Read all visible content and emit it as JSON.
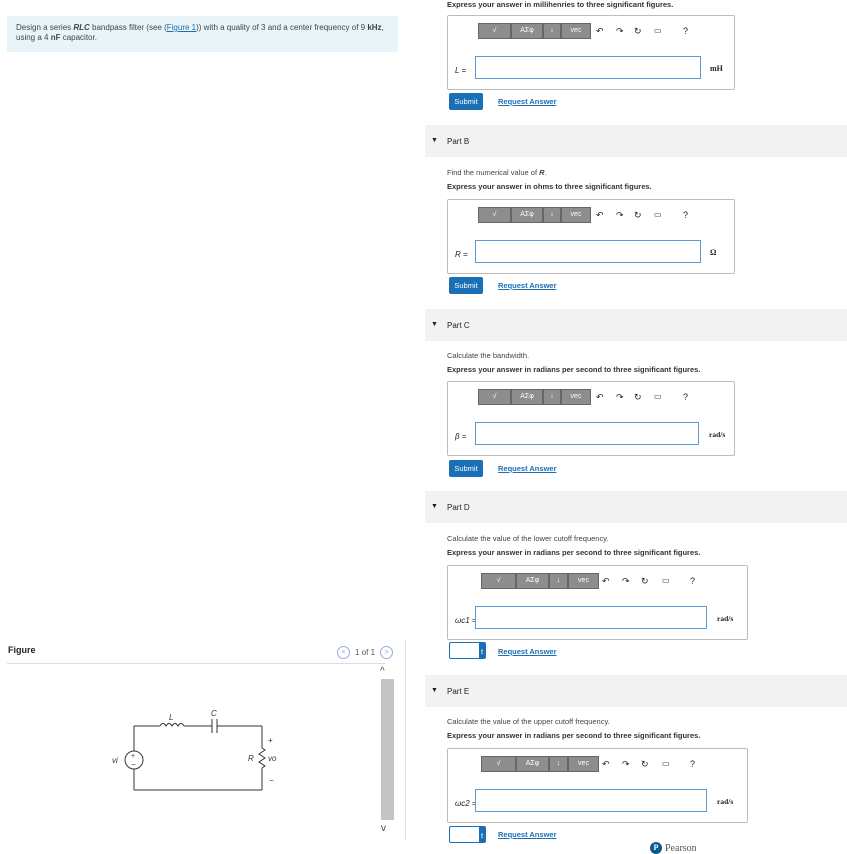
{
  "problem": {
    "text_before": "Design a series ",
    "rlc": "RLC",
    "text_mid": " bandpass filter (see (",
    "figure_link": "Figure 1",
    "text_mid2": ")) with a quality of 3 and a center frequency of 9 ",
    "khz": "kHz",
    "text_after": ", using a 4 ",
    "nf": "nF",
    "text_end": " capacitor."
  },
  "figure": {
    "title": "Figure",
    "pager": "1 of 1",
    "prev": "<",
    "next": ">",
    "labels": {
      "L": "L",
      "C": "C",
      "R": "R",
      "vi": "vi",
      "vo": "vo",
      "plus": "+",
      "minus": "−"
    }
  },
  "scroll": {
    "up": "^",
    "down": "v"
  },
  "top_express": "Express your answer in millihenries to three significant figures.",
  "parts": [
    {
      "id": "A",
      "var": "L =",
      "unit": "mH",
      "submit": "Submit",
      "request": "Request Answer"
    },
    {
      "id": "B",
      "header": "Part B",
      "find_prefix": "Find the numerical value of ",
      "find_var": "R",
      "find_suffix": ".",
      "express": "Express your answer in ohms to three significant figures.",
      "var": "R =",
      "unit": "Ω",
      "submit": "Submit",
      "request": "Request Answer"
    },
    {
      "id": "C",
      "header": "Part C",
      "find": "Calculate the bandwidth.",
      "express": "Express your answer in radians per second to three significant figures.",
      "var": "β =",
      "unit": "rad/s",
      "submit": "Submit",
      "request": "Request Answer"
    },
    {
      "id": "D",
      "header": "Part D",
      "find": "Calculate the value of the lower cutoff frequency.",
      "express": "Express your answer in radians per second to three significant figures.",
      "var": "ωc1 =",
      "unit": "rad/s",
      "submit": "t",
      "request": "Request Answer"
    },
    {
      "id": "E",
      "header": "Part E",
      "find": "Calculate the value of the upper cutoff frequency.",
      "express": "Express your answer in radians per second to three significant figures.",
      "var": "ωc2 =",
      "unit": "rad/s",
      "submit": "t",
      "request": "Request Answer"
    }
  ],
  "toolbar": {
    "t1": "√",
    "t2": "ΑΣφ",
    "t3": "↓",
    "t4": "vec",
    "undo": "↶",
    "redo": "↷",
    "reset": "↻",
    "keyboard": "▭",
    "help": "?"
  },
  "footer": {
    "brand": "Pearson",
    "logo": "P"
  },
  "colors": {
    "accent": "#1b6fb5",
    "problem_bg": "#e8f4f8",
    "header_bg": "#f2f2f2"
  }
}
